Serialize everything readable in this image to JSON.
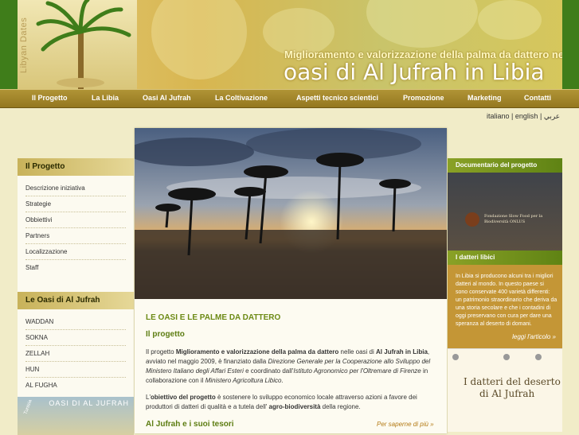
{
  "header": {
    "logo_vertical_text": "Libyan Dates",
    "subtitle": "Miglioramento e valorizzazione della palma da dattero nelle",
    "title": "oasi di Al Jufrah in Libia"
  },
  "nav": {
    "items": [
      {
        "label": "Il Progetto"
      },
      {
        "label": "La Libia"
      },
      {
        "label": "Oasi Al Jufrah"
      },
      {
        "label": "La Coltivazione"
      },
      {
        "label": "Aspetti tecnico scientici"
      },
      {
        "label": "Promozione"
      },
      {
        "label": "Marketing"
      },
      {
        "label": "Contatti"
      }
    ]
  },
  "lang": {
    "italiano": "italiano",
    "sep1": "|",
    "english": "english",
    "sep2": "|",
    "arabic": "عربي"
  },
  "left": {
    "section1_title": "Il Progetto",
    "section1_items": [
      "Descrizione iniziativa",
      "Strategie",
      "Obbiettivi",
      "Partners",
      "Localizzazione",
      "Staff"
    ],
    "section2_title": "Le Oasi di Al Jufrah",
    "section2_items": [
      "WADDAN",
      "SOKNA",
      "ZELLAH",
      "HUN",
      "AL FUGHA"
    ],
    "map_title": "OASI DI AL JUFRAH",
    "map_label": "Tunisia"
  },
  "main": {
    "title": "LE OASI E LE PALME DA DATTERO",
    "subtitle": "Il progetto",
    "p1_a": "Il progetto ",
    "p1_b": "Miglioramento e valorizzazione della palma da dattero",
    "p1_c": " nelle oasi di ",
    "p1_d": "Al Jufrah in Libia",
    "p1_e": ", avviato nel maggio 2009, è finanziato dalla ",
    "p1_f": "Direzione Generale per la Cooperazione allo Sviluppo del Ministero Italiano degli Affari Esteri",
    "p1_g": " e coordinato dall'",
    "p1_h": "Istituto Agronomico per l'Oltremare di Firenze",
    "p1_i": " in collaborazione con il ",
    "p1_j": "Ministero Agricoltura Libico",
    "p1_k": ".",
    "p2_a": "L'",
    "p2_b": "obiettivo del progetto",
    "p2_c": " è sostenere lo sviluppo economico locale attraverso azioni a favore dei produttori di datteri di qualità e a tutela dell' ",
    "p2_d": "agro-biodiversità",
    "p2_e": " della regione.",
    "subtitle2": "Al Jufrah e i suoi tesori",
    "more": "Per saperne di più »"
  },
  "right": {
    "video_title": "Documentario del progetto",
    "video_caption": "Fondazione Slow Food per la Biodiversità ONLUS",
    "datteri_title": "I datteri libici",
    "datteri_text": "In Libia si producono alcuni tra i migliori datteri al mondo. In questo paese si sono conservate 400 varietà differenti: un patrimonio straordinario che deriva da una storia secolare e che i contadini di oggi preservano con cura per dare una speranza al deserto di domani.",
    "datteri_link": "leggi l'articolo »",
    "book_title_1": "I datteri del deserto",
    "book_title_2": "di Al Jufrah"
  },
  "colors": {
    "accent_green": "#3f7d1a",
    "nav_gold": "#a38628",
    "title_green": "#6c8a14",
    "datteri_gold": "#c49636"
  }
}
